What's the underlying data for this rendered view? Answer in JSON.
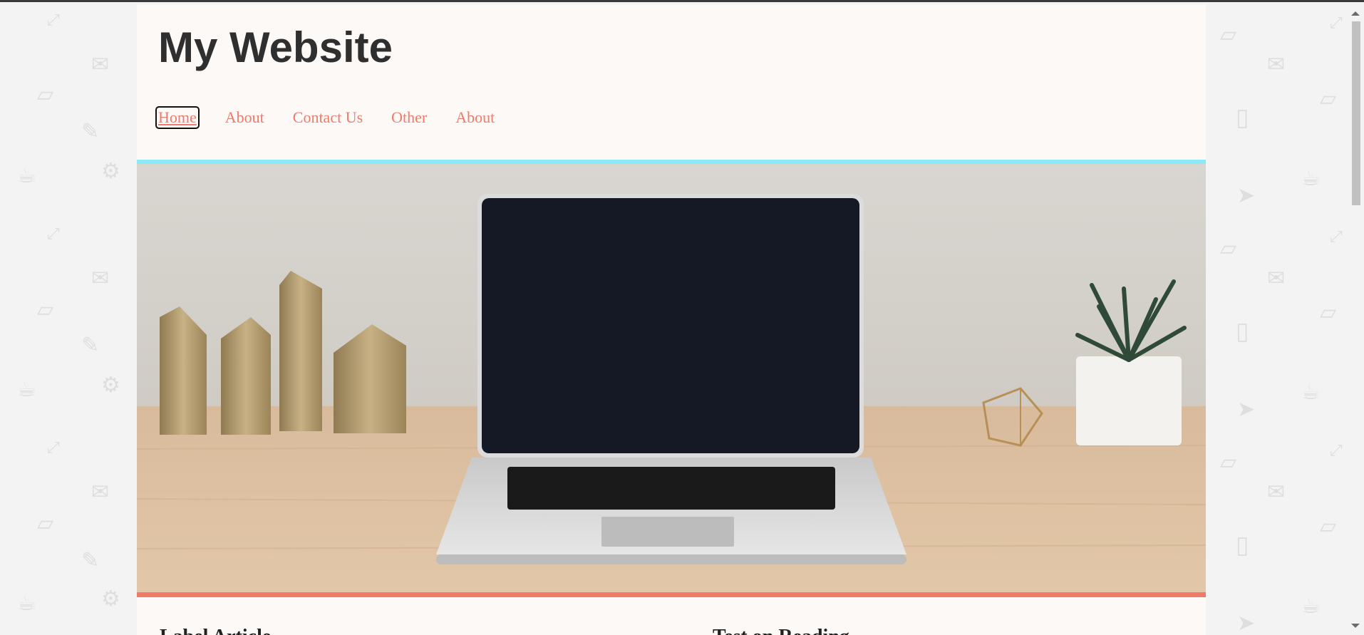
{
  "site": {
    "title": "My Website"
  },
  "nav": {
    "items": [
      {
        "label": "Home",
        "active": true
      },
      {
        "label": "About",
        "active": false
      },
      {
        "label": "Contact Us",
        "active": false
      },
      {
        "label": "Other",
        "active": false
      },
      {
        "label": "About",
        "active": false
      }
    ]
  },
  "hero": {
    "image_description_icon": "laptop-on-desk-photo"
  },
  "sections": {
    "left_heading": "Label Article",
    "right_heading": "Test on Reading"
  },
  "theme": {
    "accent_cyan": "#8be9f5",
    "accent_coral": "#ef7a6a",
    "link_color": "#ee7b6c",
    "page_bg": "#fdf9f7",
    "body_bg": "#f3f3f3"
  },
  "background_icons": [
    "envelope-icon",
    "phone-icon",
    "pencil-icon",
    "coffee-icon",
    "paper-plane-icon",
    "tablet-icon",
    "expand-icon",
    "gear-icon"
  ]
}
